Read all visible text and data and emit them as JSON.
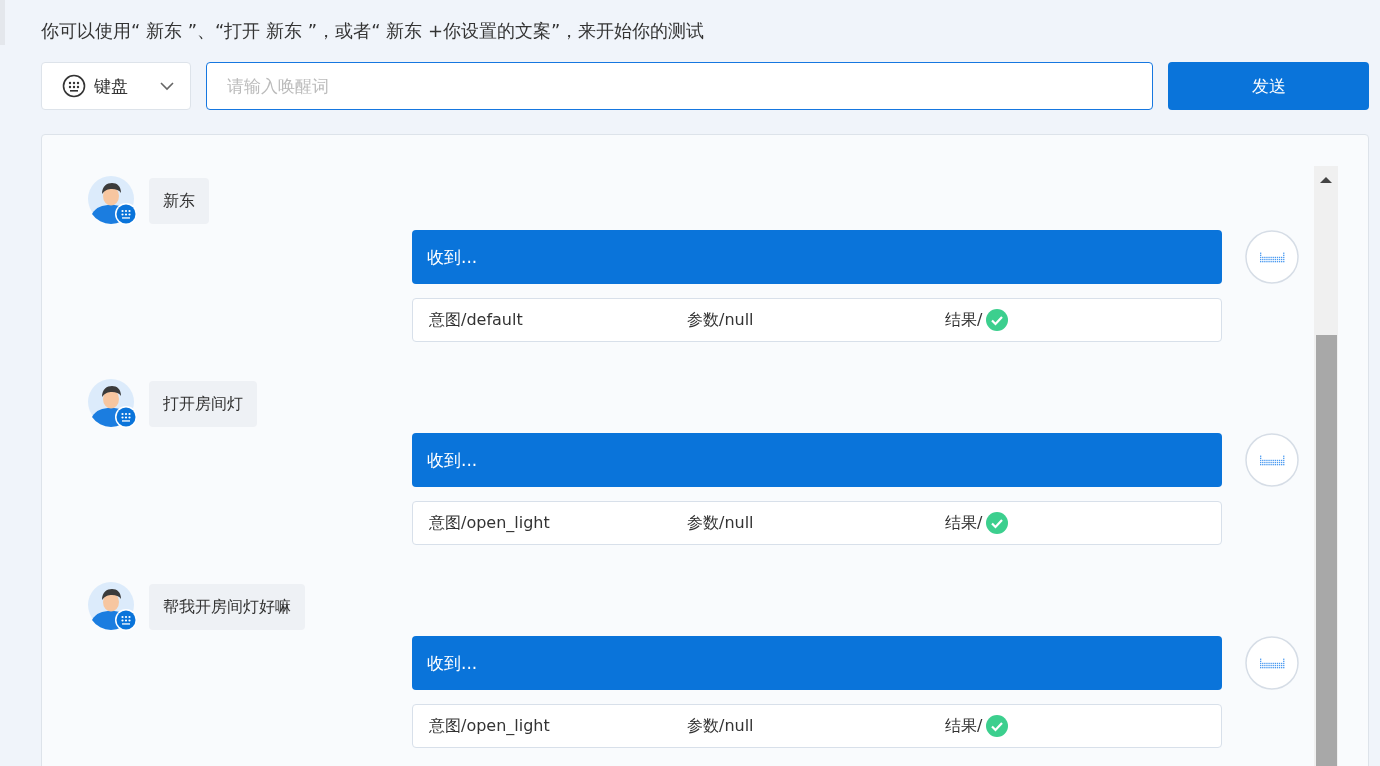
{
  "instruction": "你可以使用“ 新东 ”、“打开 新东 ”，或者“ 新东 +你设置的文案”，来开始你的测试",
  "input_mode": {
    "label": "键盘"
  },
  "wake_input": {
    "placeholder": "请输入唤醒词"
  },
  "send_button": "发送",
  "messages": [
    {
      "user_text": "新东",
      "reply": "收到...",
      "intent": "意图/default",
      "params": "参数/null",
      "result_label": "结果/",
      "success": true
    },
    {
      "user_text": "打开房间灯",
      "reply": "收到...",
      "intent": "意图/open_light",
      "params": "参数/null",
      "result_label": "结果/",
      "success": true
    },
    {
      "user_text": "帮我开房间灯好嘛",
      "reply": "收到...",
      "intent": "意图/open_light",
      "params": "参数/null",
      "result_label": "结果/",
      "success": true
    }
  ]
}
